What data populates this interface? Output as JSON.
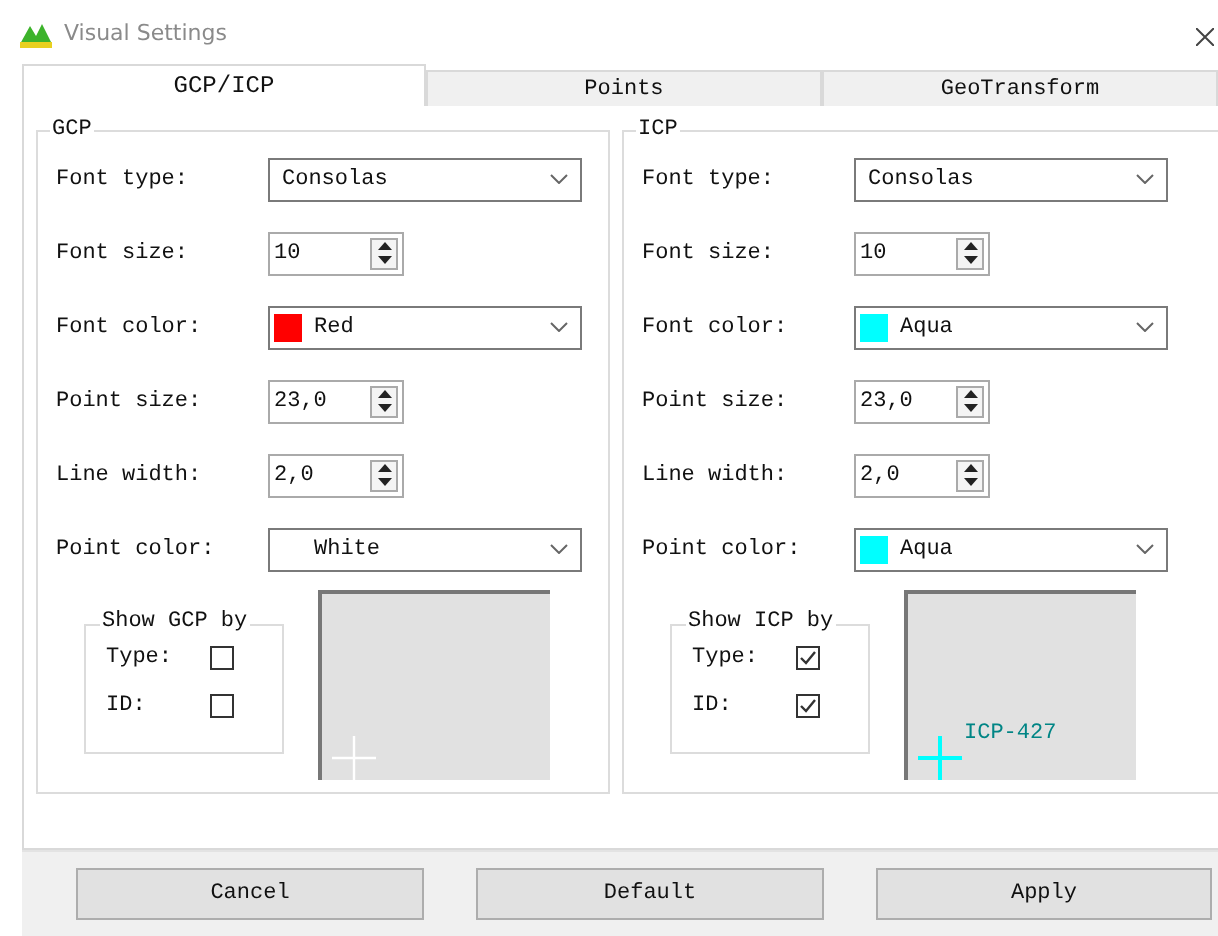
{
  "window": {
    "title": "Visual Settings"
  },
  "tabs": [
    {
      "label": "GCP/ICP",
      "selected": true
    },
    {
      "label": "Points",
      "selected": false
    },
    {
      "label": "GeoTransform",
      "selected": false
    }
  ],
  "groups": [
    {
      "title": "GCP",
      "fields": [
        {
          "kind": "combo",
          "label": "Font type:",
          "value": "Consolas"
        },
        {
          "kind": "spin",
          "label": "Font size:",
          "value": "10"
        },
        {
          "kind": "colorcombo",
          "label": "Font color:",
          "value": "Red",
          "color": "#ff0000"
        },
        {
          "kind": "spin",
          "label": "Point size:",
          "value": "23,0"
        },
        {
          "kind": "spin",
          "label": "Line width:",
          "value": "2,0"
        },
        {
          "kind": "colorcombo",
          "label": "Point color:",
          "value": "White"
        }
      ],
      "show_by": {
        "title": "Show GCP by",
        "options": [
          {
            "label": "Type:",
            "checked": false
          },
          {
            "label": "ID:",
            "checked": false
          }
        ]
      },
      "preview": {
        "color": "#ffffff"
      }
    },
    {
      "title": "ICP",
      "fields": [
        {
          "kind": "combo",
          "label": "Font type:",
          "value": "Consolas"
        },
        {
          "kind": "spin",
          "label": "Font size:",
          "value": "10"
        },
        {
          "kind": "colorcombo",
          "label": "Font color:",
          "value": "Aqua",
          "color": "#00ffff"
        },
        {
          "kind": "spin",
          "label": "Point size:",
          "value": "23,0"
        },
        {
          "kind": "spin",
          "label": "Line width:",
          "value": "2,0"
        },
        {
          "kind": "colorcombo",
          "label": "Point color:",
          "value": "Aqua",
          "color": "#00ffff"
        }
      ],
      "show_by": {
        "title": "Show ICP by",
        "options": [
          {
            "label": "Type:",
            "checked": true
          },
          {
            "label": "ID:",
            "checked": true
          }
        ]
      },
      "preview": {
        "color": "#00ffff",
        "label": "ICP-427"
      }
    }
  ],
  "buttons": [
    "Cancel",
    "Default",
    "Apply"
  ]
}
